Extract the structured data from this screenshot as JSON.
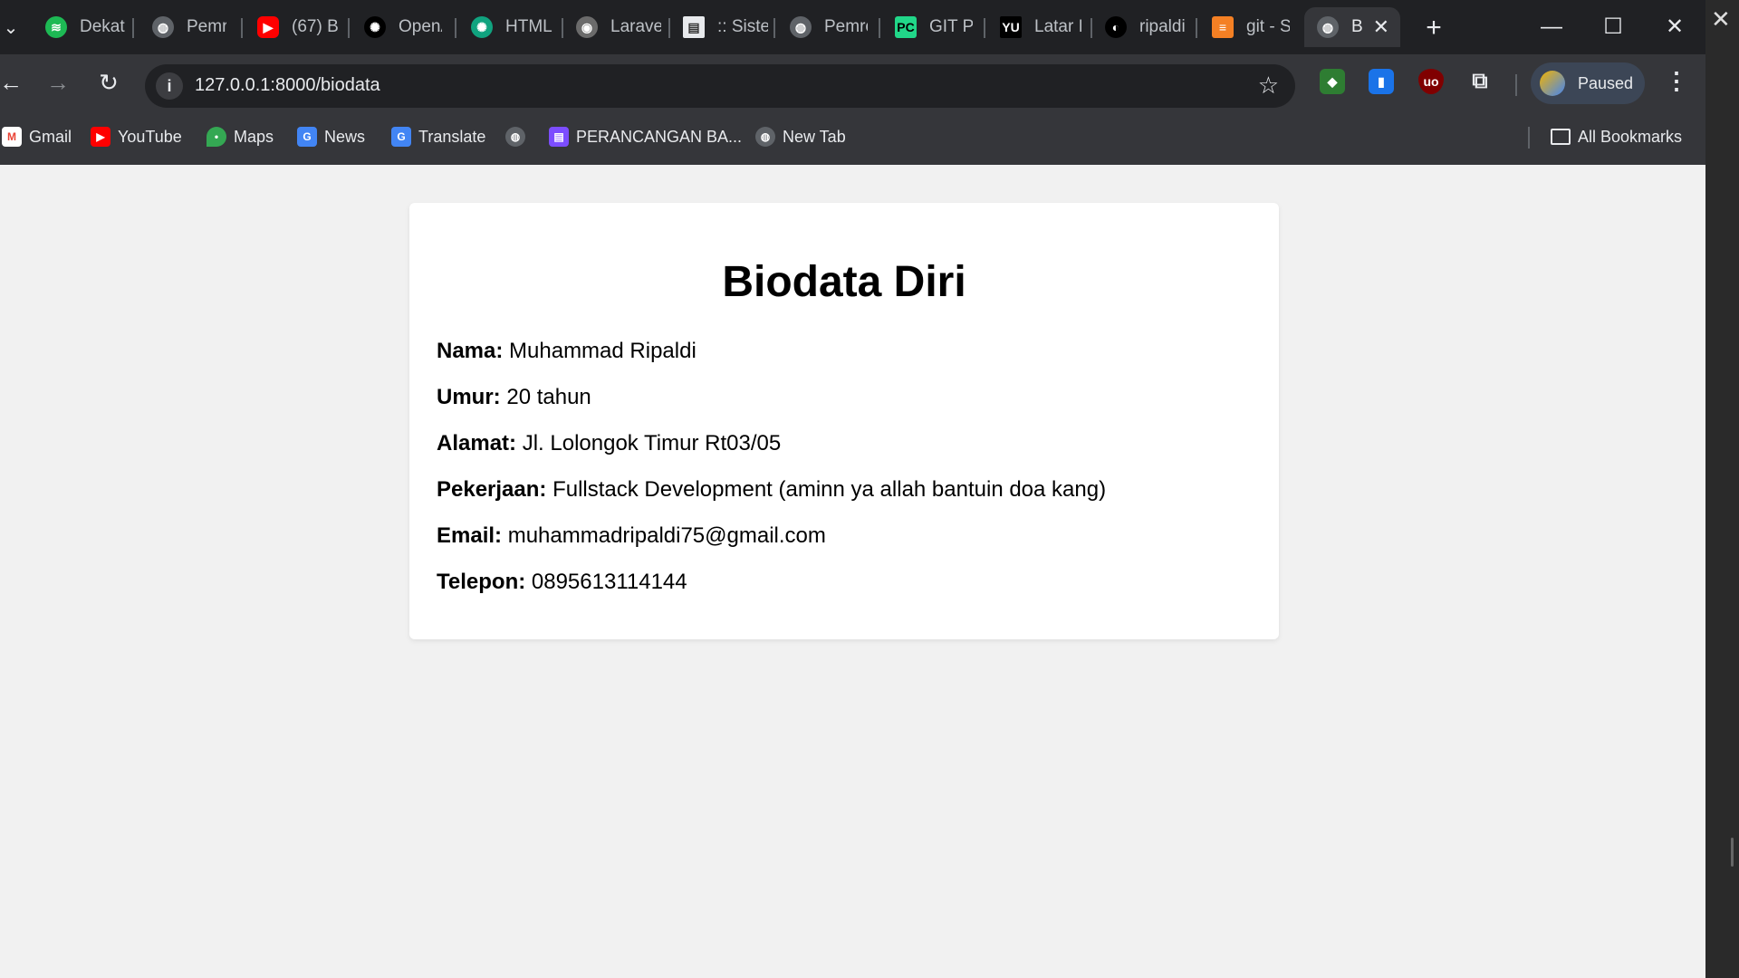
{
  "tabs": [
    {
      "title": "Dekat",
      "icon": "spotify-icon",
      "color": "#1db954"
    },
    {
      "title": "Pemrograman",
      "icon": "globe-icon",
      "color": "#5f6368"
    },
    {
      "title": "(67) B",
      "icon": "youtube-icon",
      "color": "#ff0000"
    },
    {
      "title": "OpenAI",
      "icon": "openai-icon",
      "color": "#000000"
    },
    {
      "title": "HTML",
      "icon": "chatgpt-icon",
      "color": "#10a37f"
    },
    {
      "title": "Laravel",
      "icon": "laravel-icon",
      "color": "#6b6b6b"
    },
    {
      "title": ":: Sistem",
      "icon": "page-icon",
      "color": "#e8eaed"
    },
    {
      "title": "Pemrograman",
      "icon": "globe-icon",
      "color": "#5f6368"
    },
    {
      "title": "GIT Pu",
      "icon": "pycharm-icon",
      "color": "#21d789"
    },
    {
      "title": "Latar I",
      "icon": "yu-icon",
      "color": "#000000"
    },
    {
      "title": "ripaldi",
      "icon": "github-icon",
      "color": "#000000"
    },
    {
      "title": "git - S",
      "icon": "stackoverflow-icon",
      "color": "#f48024"
    },
    {
      "title": "B",
      "icon": "globe-icon",
      "color": "#5f6368",
      "active": true
    }
  ],
  "toolbar": {
    "url": "127.0.0.1:8000/biodata",
    "profile_status": "Paused"
  },
  "bookmarks": [
    {
      "label": "Gmail",
      "icon": "gmail-icon"
    },
    {
      "label": "YouTube",
      "icon": "youtube-icon"
    },
    {
      "label": "Maps",
      "icon": "maps-icon"
    },
    {
      "label": "News",
      "icon": "news-icon"
    },
    {
      "label": "Translate",
      "icon": "translate-icon"
    },
    {
      "label": "",
      "icon": "globe-icon"
    },
    {
      "label": "PERANCANGAN BA...",
      "icon": "docs-icon"
    },
    {
      "label": "New Tab",
      "icon": "globe-icon"
    }
  ],
  "all_bookmarks_label": "All Bookmarks",
  "page": {
    "title": "Biodata Diri",
    "fields": [
      {
        "label": "Nama:",
        "value": "Muhammad Ripaldi"
      },
      {
        "label": "Umur:",
        "value": "20 tahun"
      },
      {
        "label": "Alamat:",
        "value": "Jl. Lolongok Timur Rt03/05"
      },
      {
        "label": "Pekerjaan:",
        "value": "Fullstack Development (aminn ya allah bantuin doa kang)"
      },
      {
        "label": "Email:",
        "value": "muhammadripaldi75@gmail.com"
      },
      {
        "label": "Telepon:",
        "value": "0895613114144"
      }
    ]
  }
}
